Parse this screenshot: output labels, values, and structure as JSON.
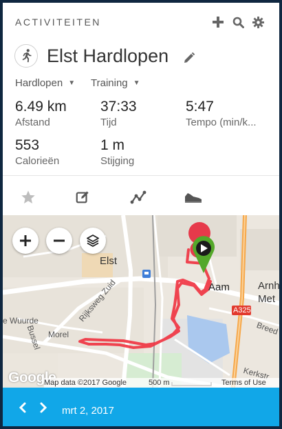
{
  "header": {
    "title": "ACTIVITEITEN",
    "icons": [
      "plus-icon",
      "search-icon",
      "gear-icon"
    ]
  },
  "activity": {
    "title": "Elst Hardlopen",
    "icon": "runner-icon",
    "type": "Hardlopen",
    "event_type": "Training"
  },
  "stats": [
    {
      "value": "6.49 km",
      "label": "Afstand"
    },
    {
      "value": "37:33",
      "label": "Tijd"
    },
    {
      "value": "5:47",
      "label": "Tempo (min/k..."
    },
    {
      "value": "553",
      "label": "Calorieën"
    },
    {
      "value": "1 m",
      "label": "Stijging"
    }
  ],
  "tabs": [
    "star-icon",
    "edit-icon",
    "chart-icon",
    "shoe-icon"
  ],
  "map": {
    "labels": {
      "elst": "Elst",
      "aam": "Aam",
      "arnh": "Arnh",
      "met": "Met",
      "a325": "A325",
      "rijksweg": "Rijksweg Zuid",
      "wuurde": "e Wuurde",
      "bussel": "Bussel",
      "morel": "Morel",
      "breed": "Breed",
      "kerkstr": "Kerkstr"
    },
    "google": "Google",
    "attribution": "Map data ©2017 Google",
    "scale": "500 m",
    "terms": "Terms of Use",
    "colors": {
      "route": "#f0313f",
      "end_marker": "#54a82a",
      "start_marker": "#e63a4b",
      "highway": "#f6a84b",
      "water": "#aac8ee"
    }
  },
  "footer": {
    "date": "mrt 2, 2017"
  }
}
